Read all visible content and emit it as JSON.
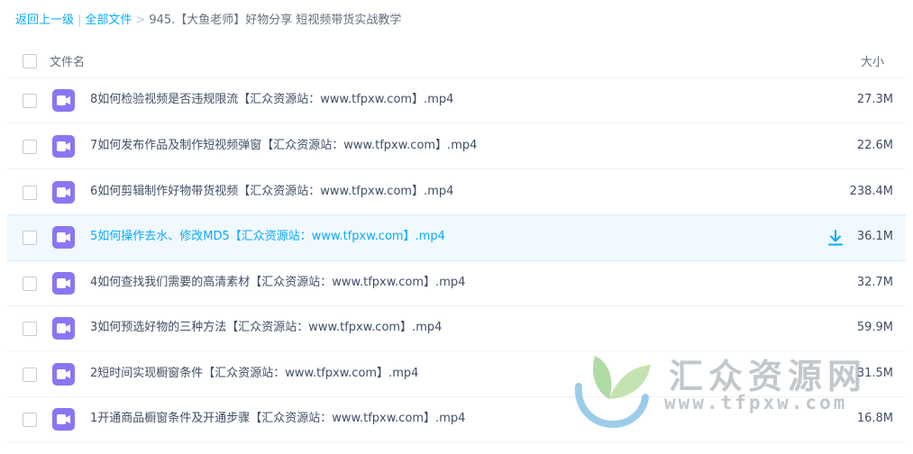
{
  "breadcrumb": {
    "back": "返回上一级",
    "all_files": "全部文件",
    "separator_bar": "|",
    "separator_arrow": ">",
    "current": "945.【大鱼老师】好物分享 短视频带货实战教学"
  },
  "table": {
    "col_name": "文件名",
    "col_size": "大小",
    "rows": [
      {
        "name": "8如何检验视频是否违规限流【汇众资源站：www.tfpxw.com】.mp4",
        "size": "27.3M"
      },
      {
        "name": "7如何发布作品及制作短视频弹窗【汇众资源站：www.tfpxw.com】.mp4",
        "size": "22.6M"
      },
      {
        "name": "6如何剪辑制作好物带货视频【汇众资源站：www.tfpxw.com】.mp4",
        "size": "238.4M"
      },
      {
        "name": "5如何操作去水、修改MD5【汇众资源站：www.tfpxw.com】.mp4",
        "size": "36.1M"
      },
      {
        "name": "4如何查找我们需要的高清素材【汇众资源站：www.tfpxw.com】.mp4",
        "size": "32.7M"
      },
      {
        "name": "3如何预选好物的三种方法【汇众资源站：www.tfpxw.com】.mp4",
        "size": "59.9M"
      },
      {
        "name": "2短时间实现橱窗条件【汇众资源站：www.tfpxw.com】.mp4",
        "size": "31.5M"
      },
      {
        "name": "1开通商品橱窗条件及开通步骤【汇众资源站：www.tfpxw.com】.mp4",
        "size": "16.8M"
      }
    ]
  },
  "watermark": {
    "title": "汇众资源网",
    "url": "www.tfpxw.com"
  },
  "colors": {
    "link": "#09aaff",
    "video_icon": "#8b76f2",
    "active_row": "#f1f9ff"
  },
  "icons": {
    "file": "video-file-icon",
    "download": "download-icon"
  }
}
